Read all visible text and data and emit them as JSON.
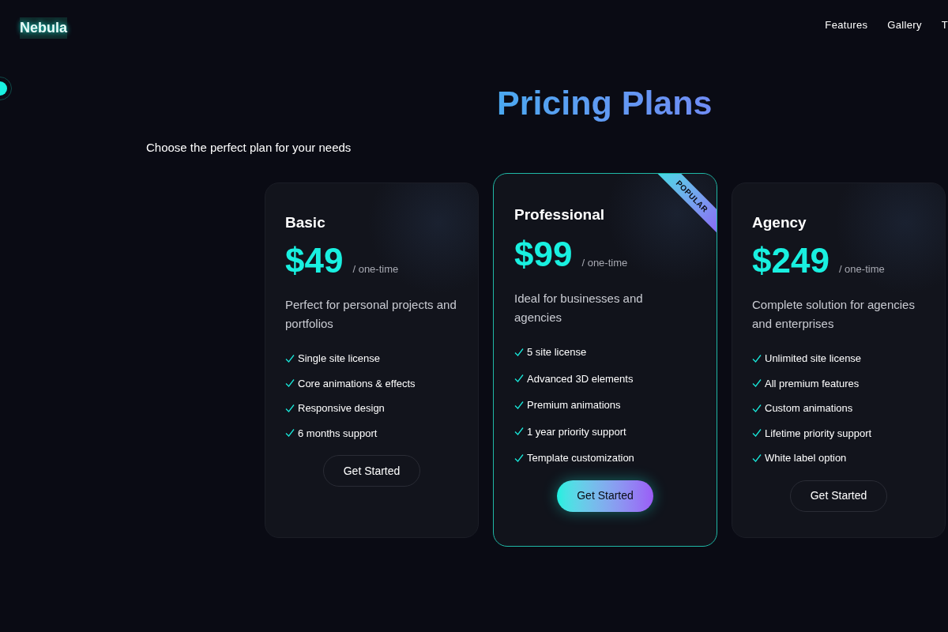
{
  "nav": {
    "logo": "Nebula",
    "links": [
      "Features",
      "Gallery",
      "T"
    ]
  },
  "hero": {
    "title": "Pricing Plans",
    "subtitle": "Choose the perfect plan for your needs"
  },
  "plans": [
    {
      "name": "Basic",
      "price": "$49",
      "period": "/ one-time",
      "description": "Perfect for personal projects and portfolios",
      "featured": false,
      "features": [
        "Single site license",
        "Core animations & effects",
        "Responsive design",
        "6 months support"
      ],
      "button": "Get Started"
    },
    {
      "name": "Professional",
      "price": "$99",
      "period": "/ one-time",
      "description": "Ideal for businesses and agencies",
      "featured": true,
      "badge": "POPULAR",
      "features": [
        "5 site license",
        "Advanced 3D elements",
        "Premium animations",
        "1 year priority support",
        "Template customization"
      ],
      "button": "Get Started"
    },
    {
      "name": "Agency",
      "price": "$249",
      "period": "/ one-time",
      "description": "Complete solution for agencies and enterprises",
      "featured": false,
      "features": [
        "Unlimited site license",
        "All premium features",
        "Custom animations",
        "Lifetime priority support",
        "White label option"
      ],
      "button": "Get Started"
    }
  ]
}
